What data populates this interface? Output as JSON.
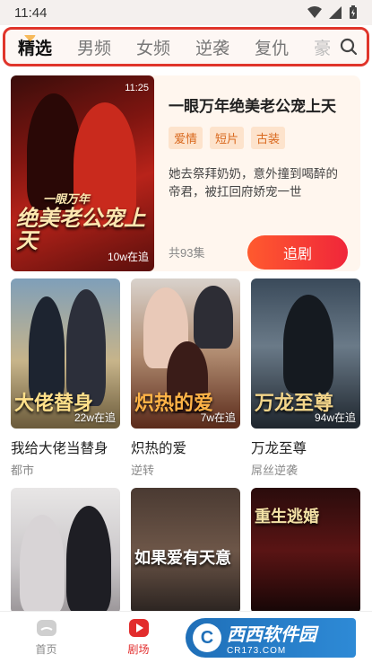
{
  "status_bar": {
    "time": "11:44"
  },
  "tabs": [
    {
      "label": "精选",
      "active": true
    },
    {
      "label": "男频",
      "active": false
    },
    {
      "label": "女频",
      "active": false
    },
    {
      "label": "逆袭",
      "active": false
    },
    {
      "label": "复仇",
      "active": false
    },
    {
      "label": "豪门",
      "active": false
    }
  ],
  "featured": {
    "poster_duration": "11:25",
    "poster_views": "10w在追",
    "poster_text_small": "一眼万年",
    "poster_text": "绝美老公宠上天",
    "title": "一眼万年绝美老公宠上天",
    "tags": [
      "爱情",
      "短片",
      "古装"
    ],
    "description": "她去祭拜奶奶，意外撞到喝醉的帝君，被扛回府娇宠一世",
    "episodes": "共93集",
    "follow_label": "追剧"
  },
  "dramas": [
    {
      "title": "我给大佬当替身",
      "genre": "都市",
      "views": "22w在追",
      "overlay": "大佬替身"
    },
    {
      "title": "炽热的爱",
      "genre": "逆转",
      "views": "7w在追",
      "overlay": "炽热的爱"
    },
    {
      "title": "万龙至尊",
      "genre": "屌丝逆袭",
      "views": "94w在追",
      "overlay": "万龙至尊"
    },
    {
      "title": "",
      "genre": "",
      "views": "",
      "overlay": ""
    },
    {
      "title": "",
      "genre": "",
      "views": "",
      "overlay": "如果爱有天意"
    },
    {
      "title": "",
      "genre": "",
      "views": "",
      "overlay": "重生逃婚"
    }
  ],
  "bottom_nav": [
    {
      "label": "首页",
      "active": false
    },
    {
      "label": "剧场",
      "active": true
    }
  ],
  "watermark": {
    "title": "西西软件园",
    "subtitle": "CR173.COM"
  },
  "colors": {
    "accent": "#e22c2c",
    "tag_text": "#d9681d",
    "tag_bg": "#fde3cc",
    "card_bg": "#fff6ee"
  }
}
